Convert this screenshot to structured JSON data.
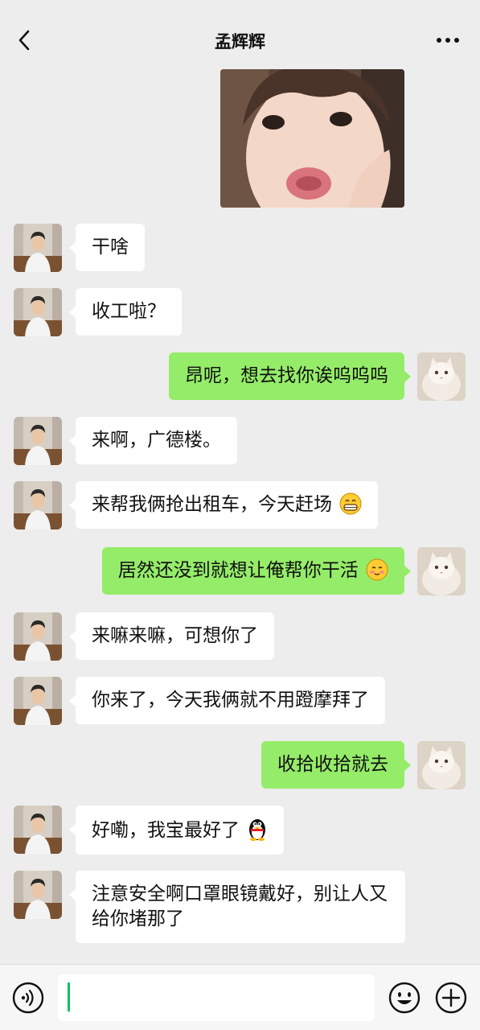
{
  "header": {
    "back_icon": "chevron-left-icon",
    "title": "孟辉辉",
    "more_icon": "more-dots-icon"
  },
  "messages": [
    {
      "side": "out",
      "type": "image",
      "content": "photo of a child"
    },
    {
      "side": "in",
      "type": "text",
      "text": "干啥"
    },
    {
      "side": "in",
      "type": "text",
      "text": "收工啦？"
    },
    {
      "side": "out",
      "type": "text",
      "text": "昂呢，想去找你诶呜呜呜"
    },
    {
      "side": "in",
      "type": "text",
      "text": "来啊，广德楼。"
    },
    {
      "side": "in",
      "type": "text",
      "text": "来帮我俩抢出租车，今天赶场",
      "emoji": "grin-emoji"
    },
    {
      "side": "out",
      "type": "text",
      "text": "居然还没到就想让俺帮你干活",
      "emoji": "blush-emoji"
    },
    {
      "side": "in",
      "type": "text",
      "text": "来嘛来嘛，可想你了"
    },
    {
      "side": "in",
      "type": "text",
      "text": "你来了，今天我俩就不用蹬摩拜了"
    },
    {
      "side": "out",
      "type": "text",
      "text": "收拾收拾就去"
    },
    {
      "side": "in",
      "type": "text",
      "text": "好嘞，我宝最好了",
      "emoji": "penguin-emoji"
    },
    {
      "side": "in",
      "type": "text",
      "text": "注意安全啊口罩眼镜戴好，别让人又给你堵那了"
    }
  ],
  "input_bar": {
    "voice_icon": "voice-icon",
    "input_value": "",
    "emoji_icon": "emoji-icon",
    "plus_icon": "plus-icon"
  },
  "colors": {
    "background": "#ededed",
    "incoming_bubble": "#ffffff",
    "outgoing_bubble": "#95ec69",
    "cursor": "#07c160"
  }
}
